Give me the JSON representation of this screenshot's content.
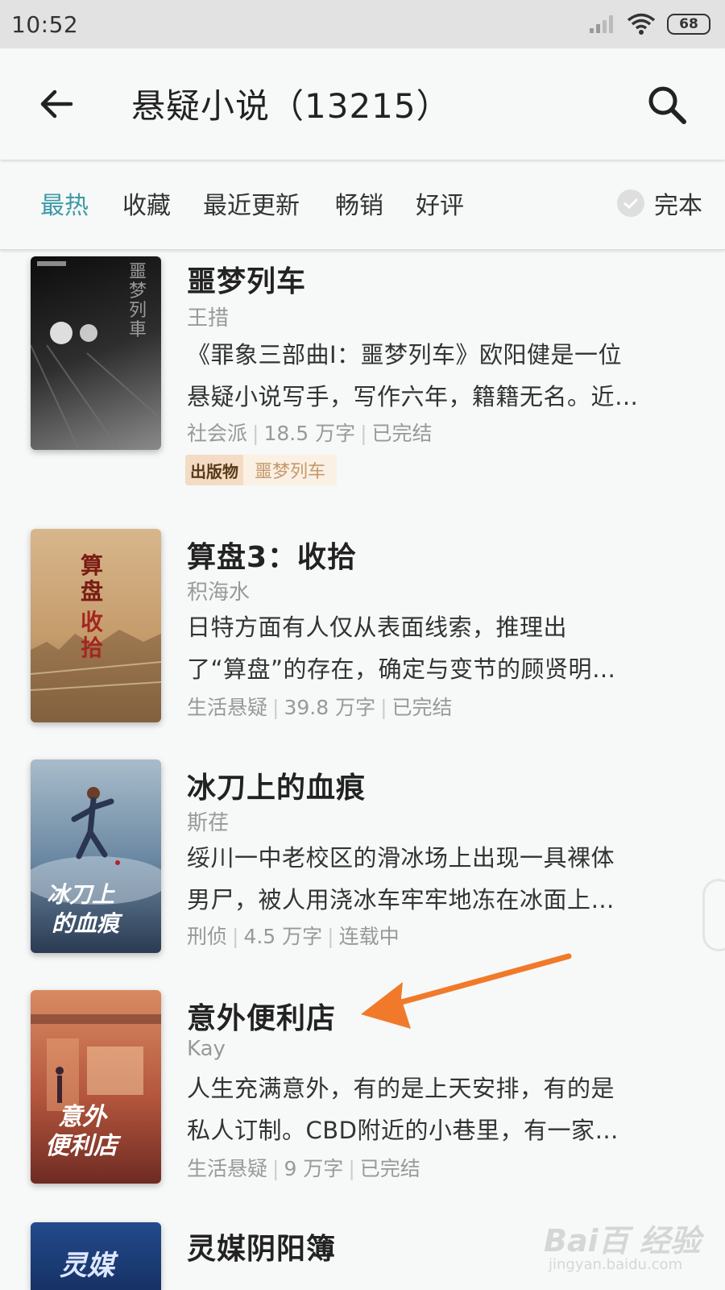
{
  "status_bar": {
    "time": "10:52",
    "battery": "68",
    "icons": [
      "signal-icon",
      "wifi-icon",
      "battery-icon"
    ]
  },
  "header": {
    "title": "悬疑小说（13215）",
    "back_icon": "back-arrow-icon",
    "search_icon": "search-icon"
  },
  "filters": {
    "tabs": [
      "最热",
      "收藏",
      "最近更新",
      "畅销",
      "好评"
    ],
    "active_index": 0,
    "toggle_label": "完本",
    "toggle_checked": false
  },
  "books": [
    {
      "title": "噩梦列车",
      "author": "王措",
      "desc_line1": "《罪象三部曲I：噩梦列车》欧阳健是一位",
      "desc_line2": "悬疑小说写手，写作六年，籍籍无名。近…",
      "genre": "社会派",
      "words": "18.5 万字",
      "status": "已完结",
      "tag_badge": "出版物",
      "tag_text": "噩梦列车"
    },
    {
      "title": "算盘3：收拾",
      "author": "积海水",
      "desc_line1": "日特方面有人仅从表面线索，推理出",
      "desc_line2": "了“算盘”的存在，确定与变节的顾贤明…",
      "genre": "生活悬疑",
      "words": "39.8 万字",
      "status": "已完结"
    },
    {
      "title": "冰刀上的血痕",
      "author": "斯荏",
      "desc_line1": "绥川一中老校区的滑冰场上出现一具裸体",
      "desc_line2": "男尸，被人用浇冰车牢牢地冻在冰面上…",
      "genre": "刑侦",
      "words": "4.5 万字",
      "status": "连载中"
    },
    {
      "title": "意外便利店",
      "author": "Kay",
      "desc_line1": "人生充满意外，有的是上天安排，有的是",
      "desc_line2": "私人订制。CBD附近的小巷里，有一家…",
      "genre": "生活悬疑",
      "words": "9 万字",
      "status": "已完结"
    },
    {
      "title": "灵媒阴阳簿"
    }
  ],
  "covers": [
    {
      "text": "噩梦列車",
      "colors": [
        "#111111",
        "#3a3a3a"
      ]
    },
    {
      "text": "算盘",
      "text2": "收拾",
      "colors": [
        "#c8a37a",
        "#e2c8a4"
      ],
      "accent": "#a4261f"
    },
    {
      "text": "冰刀上",
      "text2": "的血痕",
      "colors": [
        "#7c96ad",
        "#2c3f56"
      ]
    },
    {
      "text": "意外",
      "text2": "便利店",
      "colors": [
        "#c76a4a",
        "#7a3326"
      ]
    },
    {
      "text": "灵媒",
      "colors": [
        "#1f3f7a",
        "#153064"
      ]
    }
  ],
  "watermark": {
    "brand": "Bai百 经验",
    "url": "jingyan.baidu.com"
  },
  "colors": {
    "accent": "#3d9aa6",
    "arrow": "#f07a2a"
  }
}
